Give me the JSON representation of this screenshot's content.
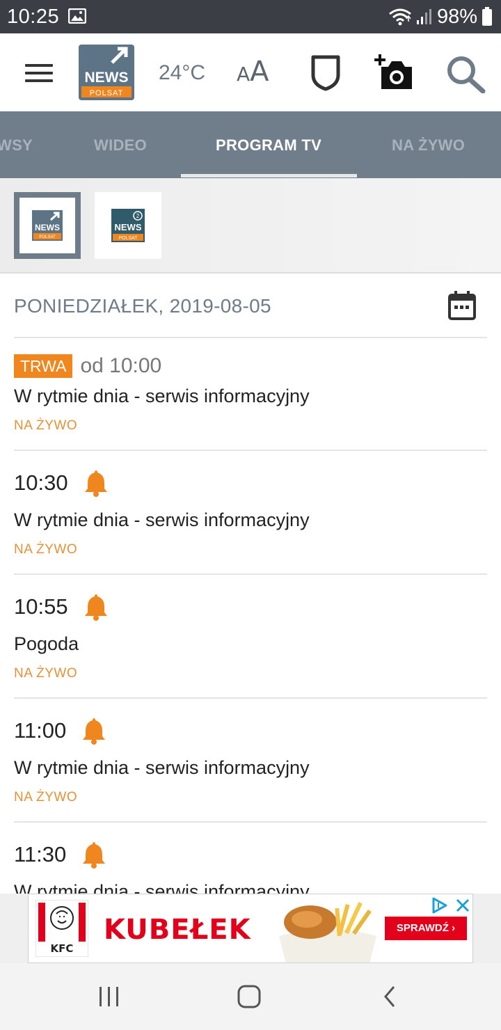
{
  "status_bar": {
    "time": "10:25",
    "battery": "98%"
  },
  "header": {
    "logo_text": "NEWS",
    "logo_sub": "POLSAT",
    "temperature": "24°C",
    "font_size_small": "A",
    "font_size_big": "A"
  },
  "tabs": [
    {
      "label": "WSY",
      "active": false
    },
    {
      "label": "WIDEO",
      "active": false
    },
    {
      "label": "PROGRAM TV",
      "active": true
    },
    {
      "label": "NA ŻYWO",
      "active": false
    }
  ],
  "channels": [
    {
      "name": "NEWS",
      "sub": "POLSAT",
      "selected": true
    },
    {
      "name": "NEWS",
      "sub": "POLSAT",
      "number": "2",
      "selected": false
    }
  ],
  "schedule": {
    "date": "PONIEDZIAŁEK, 2019-08-05",
    "programs": [
      {
        "badge": "TRWA",
        "time": "od 10:00",
        "title": "W rytmie dnia - serwis informacyjny",
        "status": "NA ŻYWO"
      },
      {
        "time": "10:30",
        "title": "W rytmie dnia - serwis informacyjny",
        "status": "NA ŻYWO"
      },
      {
        "time": "10:55",
        "title": "Pogoda",
        "status": "NA ŻYWO"
      },
      {
        "time": "11:00",
        "title": "W rytmie dnia - serwis informacyjny",
        "status": "NA ŻYWO"
      },
      {
        "time": "11:30",
        "title": "W rytmie dnia - serwis informacyjny",
        "status": ""
      }
    ]
  },
  "ad": {
    "brand": "KFC",
    "headline": "KUBEŁEK",
    "cta": "SPRAWDŹ ›"
  },
  "colors": {
    "status_bar": "#3b3f45",
    "tabs_bg": "#707e8c",
    "accent_orange": "#f0861e",
    "kfc_red": "#e2001a"
  },
  "icons": [
    "image-icon",
    "wifi-icon",
    "signal-icon",
    "battery-icon",
    "menu-icon",
    "shield-icon",
    "add-photo-icon",
    "search-icon",
    "calendar-icon",
    "bell-icon",
    "ad-choices-icon",
    "close-icon",
    "recent-apps-icon",
    "home-icon",
    "back-icon"
  ]
}
